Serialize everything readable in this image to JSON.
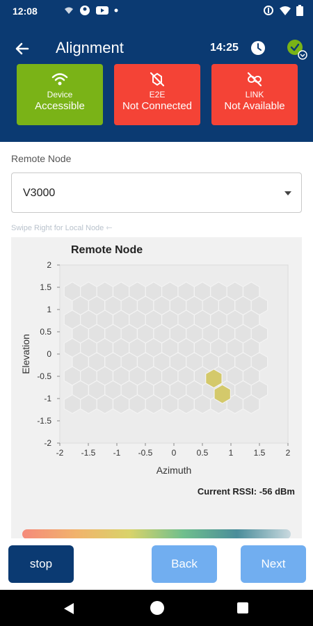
{
  "status_bar": {
    "time": "12:08",
    "icons_left": [
      "wifi-calling-icon",
      "account-circle-icon",
      "youtube-icon",
      "dot-icon"
    ],
    "icons_right": [
      "vibrate-icon",
      "wifi-icon",
      "battery-icon"
    ]
  },
  "app_bar": {
    "title": "Alignment",
    "clock": "14:25",
    "back_icon": "arrow-left-icon",
    "clock_icon": "clock-icon",
    "status_icon": "check-circle-icon"
  },
  "tiles": [
    {
      "icon": "wifi-icon",
      "line1": "Device",
      "line2": "Accessible",
      "color": "#7ab317"
    },
    {
      "icon": "e2e-off-icon",
      "line1": "E2E",
      "line2": "Not Connected",
      "color": "#f44336"
    },
    {
      "icon": "link-off-icon",
      "line1": "LINK",
      "line2": "Not Available",
      "color": "#f44336"
    }
  ],
  "remote_node_field": {
    "label": "Remote Node",
    "value": "V3000"
  },
  "swipe_hint": "Swipe Right for Local Node ⇽",
  "chart_data": {
    "type": "heatmap",
    "title": "Remote Node",
    "xlabel": "Azimuth",
    "ylabel": "Elevation",
    "xlim": [
      -2,
      2
    ],
    "ylim": [
      -2,
      2
    ],
    "xticks": [
      "-2",
      "-1.5",
      "-1",
      "-0.5",
      "0",
      "0.5",
      "1",
      "1.5",
      "2"
    ],
    "yticks": [
      "2",
      "1.5",
      "1",
      "0.5",
      "0",
      "-0.5",
      "-1",
      "-1.5",
      "-2"
    ],
    "highlighted_cells": [
      {
        "azimuth": 0.7,
        "elevation": -0.55,
        "color": "#d4c96b"
      },
      {
        "azimuth": 0.85,
        "elevation": -0.9,
        "color": "#d4c96b"
      }
    ],
    "background_cell_color": "#e2e2e2",
    "grid": true
  },
  "rssi": {
    "label": "Current RSSI: -56 dBm"
  },
  "buttons": {
    "stop": "stop",
    "back": "Back",
    "next": "Next"
  },
  "colors": {
    "primary": "#0b3a72",
    "success": "#7ab317",
    "danger": "#f44336",
    "secondary_button": "#71aef0"
  }
}
